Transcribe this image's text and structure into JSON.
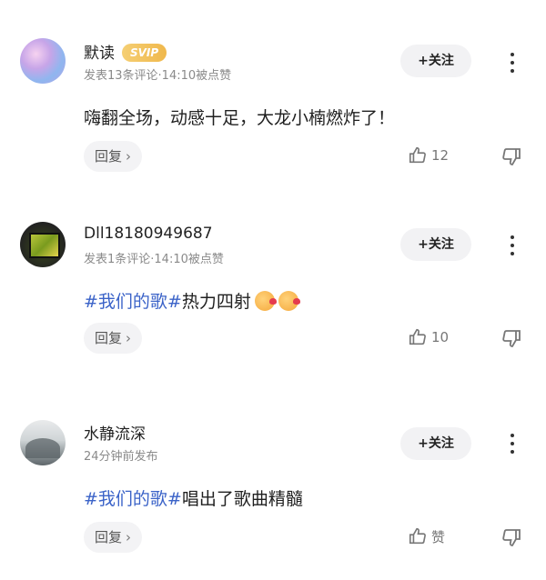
{
  "comments": [
    {
      "username": "默读",
      "badge": "SVIP",
      "meta": "发表13条评论·14:10被点赞",
      "follow_label": "+关注",
      "content": "嗨翻全场，动感十足，大龙小楠燃炸了！",
      "reply_label": "回复",
      "reply_chevron": "›",
      "likes": "12"
    },
    {
      "username": "Dll18180949687",
      "meta": "发表1条评论·14:10被点赞",
      "follow_label": "+关注",
      "tag": "#我们的歌#",
      "content": "热力四射",
      "emoji_names": [
        "kiss-face-emoji",
        "kiss-face-emoji"
      ],
      "reply_label": "回复",
      "reply_chevron": "›",
      "likes": "10"
    },
    {
      "username": "水静流深",
      "meta": "24分钟前发布",
      "follow_label": "+关注",
      "tag": "#我们的歌#",
      "content": "唱出了歌曲精髓",
      "reply_label": "回复",
      "reply_chevron": "›",
      "likes": "赞"
    }
  ],
  "colors": {
    "tag": "#3b63c8",
    "badge_gold": "#f0b84c",
    "button_bg": "#f2f2f4",
    "meta_gray": "#8a8a8a"
  },
  "icons": [
    "more-icon",
    "thumbs-up-icon",
    "thumbs-down-icon"
  ]
}
